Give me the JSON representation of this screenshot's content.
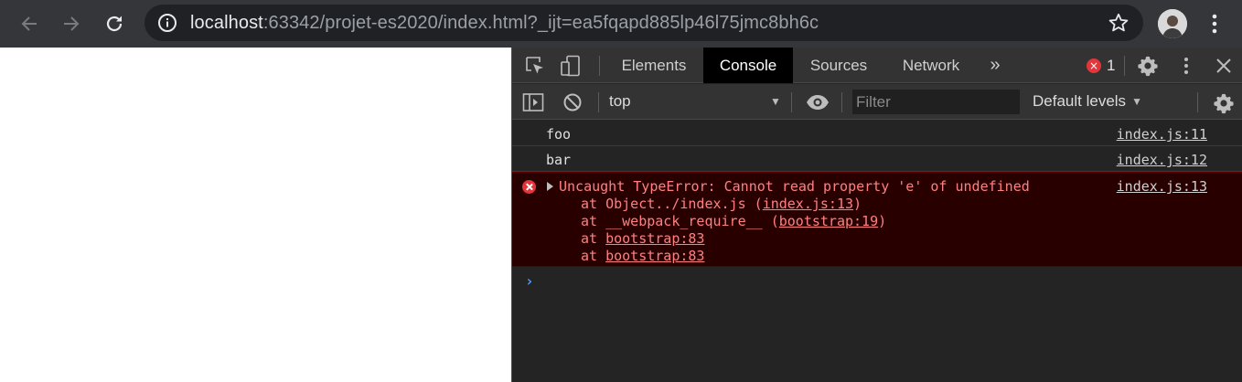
{
  "browser": {
    "url_host": "localhost",
    "url_rest": ":63342/projet-es2020/index.html?_ijt=ea5fqapd885lp46l75jmc8bh6c",
    "icons": [
      "back-arrow-icon",
      "forward-arrow-icon",
      "reload-icon",
      "info-icon",
      "star-icon",
      "avatar",
      "kebab-menu-icon"
    ]
  },
  "devtools": {
    "tabs": [
      {
        "label": "Elements"
      },
      {
        "label": "Console"
      },
      {
        "label": "Sources"
      },
      {
        "label": "Network"
      }
    ],
    "active_tab": "Console",
    "more_tabs": "»",
    "error_count": "1",
    "filterbar": {
      "context": "top",
      "filter_placeholder": "Filter",
      "levels": "Default levels"
    },
    "messages": [
      {
        "type": "log",
        "text": "foo",
        "source": "index.js:11"
      },
      {
        "type": "log",
        "text": "bar",
        "source": "index.js:12"
      },
      {
        "type": "error",
        "text": "Uncaught TypeError: Cannot read property 'e' of undefined",
        "source": "index.js:13",
        "stack": [
          {
            "prefix": "at Object../index.js (",
            "link": "index.js:13",
            "suffix": ")"
          },
          {
            "prefix": "at __webpack_require__ (",
            "link": "bootstrap:19",
            "suffix": ")"
          },
          {
            "prefix": "at ",
            "link": "bootstrap:83",
            "suffix": ""
          },
          {
            "prefix": "at ",
            "link": "bootstrap:83",
            "suffix": ""
          }
        ]
      }
    ],
    "prompt": "›",
    "colors": {
      "error_text": "#ff8080",
      "error_bg": "#290000",
      "error_icon": "#e2363a",
      "prompt": "#4e9cff"
    }
  }
}
